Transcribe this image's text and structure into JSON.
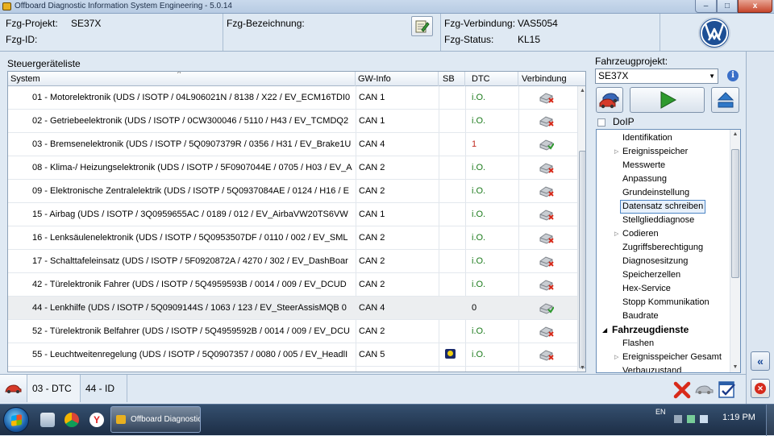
{
  "window": {
    "title": "Offboard Diagnostic Information System Engineering - 5.0.14",
    "minimize": "–",
    "maximize": "□",
    "close": "x"
  },
  "header": {
    "project_label": "Fzg-Projekt:",
    "project_value": "SE37X",
    "id_label": "Fzg-ID:",
    "name_label": "Fzg-Bezeichnung:",
    "connection_label": "Fzg-Verbindung:",
    "connection_value": "VAS5054",
    "status_label": "Fzg-Status:",
    "status_value": "KL15"
  },
  "list": {
    "caption": "Steuergeräteliste",
    "columns": [
      "System",
      "GW-Info",
      "SB",
      "DTC",
      "Verbindung"
    ],
    "rows": [
      {
        "system": "01 - Motorelektronik  (UDS / ISOTP / 04L906021N / 8138 / X22 / EV_ECM16TDI0",
        "gw": "CAN 1",
        "sb": "",
        "dtc": "i.O.",
        "dtc_type": "ok",
        "conn": "disconnected"
      },
      {
        "system": "02 - Getriebeelektronik  (UDS / ISOTP / 0CW300046 / 5110 / H43 / EV_TCMDQ2",
        "gw": "CAN 1",
        "sb": "",
        "dtc": "i.O.",
        "dtc_type": "ok",
        "conn": "disconnected"
      },
      {
        "system": "03 - Bremsenelektronik  (UDS / ISOTP / 5Q0907379R / 0356 / H31 / EV_Brake1U",
        "gw": "CAN 4",
        "sb": "",
        "dtc": "1",
        "dtc_type": "err",
        "conn": "connected"
      },
      {
        "system": "08 - Klima-/ Heizungselektronik  (UDS / ISOTP / 5F0907044E / 0705 / H03 / EV_A",
        "gw": "CAN 2",
        "sb": "",
        "dtc": "i.O.",
        "dtc_type": "ok",
        "conn": "disconnected"
      },
      {
        "system": "09 - Elektronische Zentralelektrik  (UDS / ISOTP / 5Q0937084AE / 0124 / H16 / E",
        "gw": "CAN 2",
        "sb": "",
        "dtc": "i.O.",
        "dtc_type": "ok",
        "conn": "disconnected"
      },
      {
        "system": "15 - Airbag  (UDS / ISOTP / 3Q0959655AC / 0189 / 012 / EV_AirbaVW20TS6VW",
        "gw": "CAN 1",
        "sb": "",
        "dtc": "i.O.",
        "dtc_type": "ok",
        "conn": "disconnected"
      },
      {
        "system": "16 - Lenksäulenelektronik  (UDS / ISOTP / 5Q0953507DF / 0110 / 002 / EV_SML",
        "gw": "CAN 2",
        "sb": "",
        "dtc": "i.O.",
        "dtc_type": "ok",
        "conn": "disconnected"
      },
      {
        "system": "17 - Schalttafeleinsatz  (UDS / ISOTP / 5F0920872A / 4270 / 302 / EV_DashBoar",
        "gw": "CAN 2",
        "sb": "",
        "dtc": "i.O.",
        "dtc_type": "ok",
        "conn": "disconnected"
      },
      {
        "system": "42 - Türelektronik Fahrer  (UDS / ISOTP / 5Q4959593B / 0014 / 009 / EV_DCUD",
        "gw": "CAN 2",
        "sb": "",
        "dtc": "i.O.",
        "dtc_type": "ok",
        "conn": "disconnected"
      },
      {
        "system": "44 - Lenkhilfe  (UDS / ISOTP / 5Q0909144S / 1063 / 123 / EV_SteerAssisMQB 0",
        "gw": "CAN 4",
        "sb": "",
        "dtc": "0",
        "dtc_type": "zero",
        "conn": "connected",
        "selected": true
      },
      {
        "system": "52 - Türelektronik Belfahrer  (UDS / ISOTP / 5Q4959592B / 0014 / 009 / EV_DCU",
        "gw": "CAN 2",
        "sb": "",
        "dtc": "i.O.",
        "dtc_type": "ok",
        "conn": "disconnected"
      },
      {
        "system": "55 - Leuchtweitenregelung  (UDS / ISOTP / 5Q0907357 / 0080 / 005 / EV_HeadlI",
        "gw": "CAN 5",
        "sb": "icon",
        "dtc": "i.O.",
        "dtc_type": "ok",
        "conn": "disconnected"
      }
    ]
  },
  "right": {
    "project_label": "Fahrzeugprojekt:",
    "project_value": "SE37X",
    "doip_label": "DoIP",
    "tree": [
      {
        "label": "Identifikation",
        "type": "item"
      },
      {
        "label": "Ereignisspeicher",
        "type": "item",
        "expandable": true
      },
      {
        "label": "Messwerte",
        "type": "item"
      },
      {
        "label": "Anpassung",
        "type": "item"
      },
      {
        "label": "Grundeinstellung",
        "type": "item"
      },
      {
        "label": "Datensatz schreiben",
        "type": "item",
        "selected": true
      },
      {
        "label": "Stellglieddiagnose",
        "type": "item"
      },
      {
        "label": "Codieren",
        "type": "item",
        "expandable": true
      },
      {
        "label": "Zugriffsberechtigung",
        "type": "item"
      },
      {
        "label": "Diagnosesitzung",
        "type": "item"
      },
      {
        "label": "Speicherzellen",
        "type": "item"
      },
      {
        "label": "Hex-Service",
        "type": "item"
      },
      {
        "label": "Stopp Kommunikation",
        "type": "item"
      },
      {
        "label": "Baudrate",
        "type": "item"
      },
      {
        "label": "Fahrzeugdienste",
        "type": "group"
      },
      {
        "label": "Flashen",
        "type": "item"
      },
      {
        "label": "Ereignisspeicher Gesamt",
        "type": "item",
        "expandable": true
      },
      {
        "label": "Verbauzustand",
        "type": "item"
      }
    ]
  },
  "bottom": {
    "tab_dtc": "03 - DTC",
    "tab_id": "44 - ID"
  },
  "taskbar": {
    "app_label": "Offboard Diagnostic ...",
    "lang": "EN",
    "time": "1:19 PM"
  },
  "colors": {
    "ok": "#1a7a1a",
    "error": "#c0281e",
    "accent": "#1d5fb0"
  }
}
